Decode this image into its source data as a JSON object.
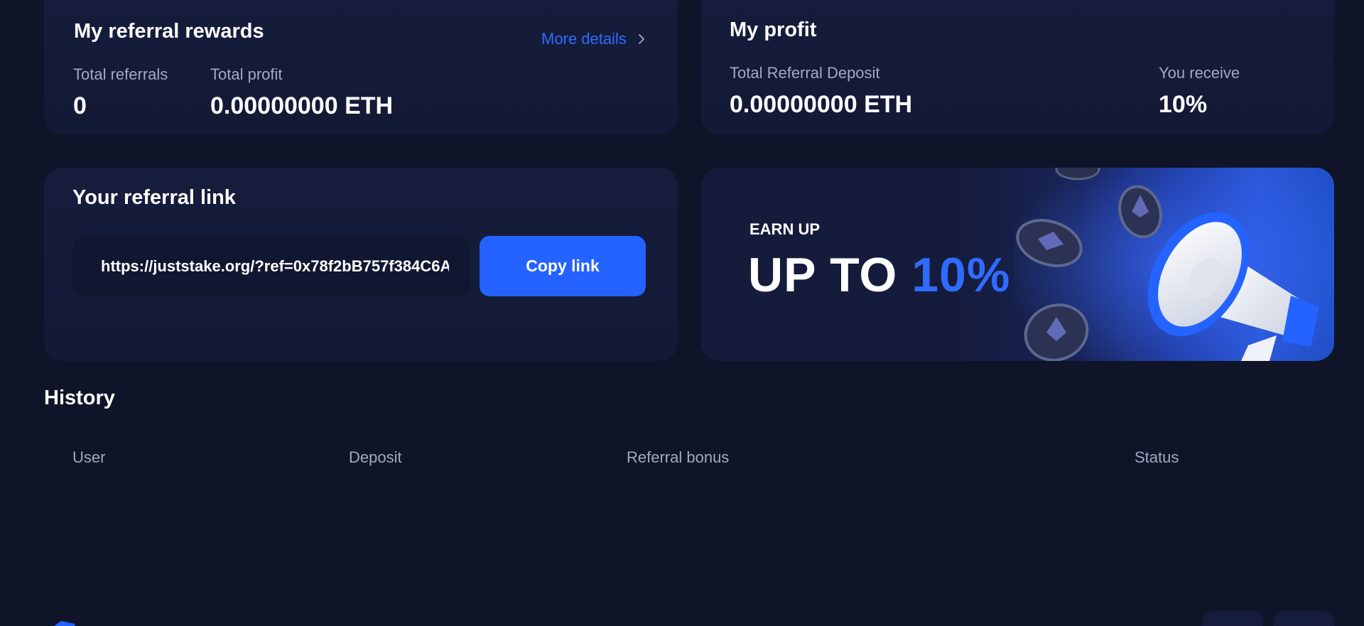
{
  "referral_rewards": {
    "title": "My referral rewards",
    "more_details_label": "More details",
    "total_referrals_label": "Total referrals",
    "total_referrals_value": "0",
    "total_profit_label": "Total profit",
    "total_profit_value": "0.00000000 ETH"
  },
  "my_profit": {
    "title": "My profit",
    "deposit_label": "Total Referral Deposit",
    "deposit_value": "0.00000000 ETH",
    "receive_label": "You receive",
    "receive_value": "10%"
  },
  "referral_link": {
    "title": "Your referral link",
    "url": "https://juststake.org/?ref=0x78f2bB757f384C6A",
    "copy_label": "Copy link"
  },
  "banner": {
    "small_text": "EARN UP",
    "big_text_prefix": "UP TO ",
    "big_text_accent": "10%"
  },
  "history": {
    "title": "History",
    "columns": [
      "User",
      "Deposit",
      "Referral bonus",
      "Status"
    ]
  },
  "icons": {
    "chevron": "chevron-right-icon",
    "megaphone": "megaphone-icon",
    "coin": "eth-coin-icon"
  },
  "colors": {
    "background": "#0f1428",
    "card": "#161d3c",
    "accent": "#2463ff",
    "muted_text": "#a3a9c2"
  }
}
